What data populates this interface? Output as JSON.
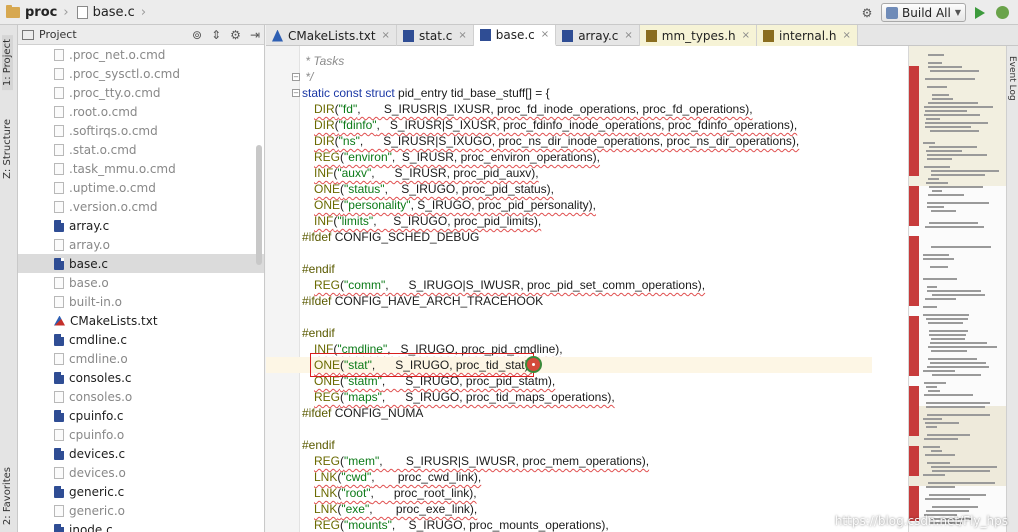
{
  "breadcrumb": {
    "folder": "proc",
    "file": "base.c"
  },
  "toolbar": {
    "build_config": "Build All",
    "icons": [
      "gear-icon",
      "build-config-icon",
      "run-icon",
      "debug-icon"
    ]
  },
  "left_stripe": {
    "tabs": [
      "1: Project",
      "Z: Structure",
      "2: Favorites"
    ]
  },
  "right_stripe": {
    "tabs": [
      "Event Log"
    ]
  },
  "project_panel": {
    "title": "Project",
    "tool_icons": [
      "sync-icon",
      "collapse-icon",
      "settings-icon",
      "hide-icon"
    ],
    "items": [
      {
        "label": ".proc_net.o.cmd",
        "kind": "obj"
      },
      {
        "label": ".proc_sysctl.o.cmd",
        "kind": "obj"
      },
      {
        "label": ".proc_tty.o.cmd",
        "kind": "obj"
      },
      {
        "label": ".root.o.cmd",
        "kind": "obj"
      },
      {
        "label": ".softirqs.o.cmd",
        "kind": "obj"
      },
      {
        "label": ".stat.o.cmd",
        "kind": "obj"
      },
      {
        "label": ".task_mmu.o.cmd",
        "kind": "obj"
      },
      {
        "label": ".uptime.o.cmd",
        "kind": "obj"
      },
      {
        "label": ".version.o.cmd",
        "kind": "obj"
      },
      {
        "label": "array.c",
        "kind": "src"
      },
      {
        "label": "array.o",
        "kind": "obj"
      },
      {
        "label": "base.c",
        "kind": "src",
        "selected": true
      },
      {
        "label": "base.o",
        "kind": "obj"
      },
      {
        "label": "built-in.o",
        "kind": "obj"
      },
      {
        "label": "CMakeLists.txt",
        "kind": "cmake"
      },
      {
        "label": "cmdline.c",
        "kind": "src"
      },
      {
        "label": "cmdline.o",
        "kind": "obj"
      },
      {
        "label": "consoles.c",
        "kind": "src"
      },
      {
        "label": "consoles.o",
        "kind": "obj"
      },
      {
        "label": "cpuinfo.c",
        "kind": "src"
      },
      {
        "label": "cpuinfo.o",
        "kind": "obj"
      },
      {
        "label": "devices.c",
        "kind": "src"
      },
      {
        "label": "devices.o",
        "kind": "obj"
      },
      {
        "label": "generic.c",
        "kind": "src"
      },
      {
        "label": "generic.o",
        "kind": "obj"
      },
      {
        "label": "inode.c",
        "kind": "src"
      }
    ]
  },
  "tabs": [
    {
      "label": "CMakeLists.txt",
      "icon": "cmake",
      "active": false
    },
    {
      "label": "stat.c",
      "icon": "src",
      "active": false
    },
    {
      "label": "base.c",
      "icon": "src",
      "active": true
    },
    {
      "label": "array.c",
      "icon": "src",
      "active": false
    },
    {
      "label": "mm_types.h",
      "icon": "hdr",
      "active": false
    },
    {
      "label": "internal.h",
      "icon": "hdr",
      "active": false
    }
  ],
  "editor": {
    "lines": [
      {
        "type": "comment",
        "text": " * Tasks"
      },
      {
        "type": "comment",
        "text": " */"
      },
      {
        "type": "decl",
        "kw": "static const struct ",
        "name": "pid_entry",
        "rest": " tid_base_stuff[] = {"
      },
      {
        "type": "entry",
        "macro": "DIR",
        "str": "\"fd\"",
        "args": ",       S_IRUSR|S_IXUSR, proc_fd_inode_operations, proc_fd_operations),"
      },
      {
        "type": "entry",
        "macro": "DIR",
        "str": "\"fdinfo\"",
        "args": ",   S_IRUSR|S_IXUSR, proc_fdinfo_inode_operations, proc_fdinfo_operations),"
      },
      {
        "type": "entry",
        "macro": "DIR",
        "str": "\"ns\"",
        "args": ",      S_IRUSR|S_IXUGO, proc_ns_dir_inode_operations, proc_ns_dir_operations),"
      },
      {
        "type": "entry",
        "macro": "REG",
        "str": "\"environ\"",
        "args": ",  S_IRUSR, proc_environ_operations),"
      },
      {
        "type": "entry",
        "macro": "INF",
        "str": "\"auxv\"",
        "args": ",      S_IRUSR, proc_pid_auxv),"
      },
      {
        "type": "entry",
        "macro": "ONE",
        "str": "\"status\"",
        "args": ",    S_IRUGO, proc_pid_status),"
      },
      {
        "type": "entry",
        "macro": "ONE",
        "str": "\"personality\"",
        "args": ", S_IRUGO, proc_pid_personality),"
      },
      {
        "type": "entry",
        "macro": "INF",
        "str": "\"limits\"",
        "args": ",     S_IRUGO, proc_pid_limits),"
      },
      {
        "type": "pp",
        "directive": "#ifdef",
        "rest": " CONFIG_SCHED_DEBUG"
      },
      {
        "type": "blank",
        "text": ""
      },
      {
        "type": "pp",
        "directive": "#endif",
        "rest": ""
      },
      {
        "type": "entry",
        "macro": "REG",
        "str": "\"comm\"",
        "args": ",      S_IRUGO|S_IWUSR, proc_pid_set_comm_operations),"
      },
      {
        "type": "pp",
        "directive": "#ifdef",
        "rest": " CONFIG_HAVE_ARCH_TRACEHOOK"
      },
      {
        "type": "blank",
        "text": ""
      },
      {
        "type": "pp",
        "directive": "#endif",
        "rest": ""
      },
      {
        "type": "entry",
        "macro": "INF",
        "str": "\"cmdline\"",
        "args": ",   S_IRUGO, proc_pid_cmdline),"
      },
      {
        "type": "entry",
        "macro": "ONE",
        "str": "\"stat\"",
        "args": ",      S_IRUGO, proc_tid_stat),",
        "current": true
      },
      {
        "type": "entry",
        "macro": "ONE",
        "str": "\"statm\"",
        "args": ",      S_IRUGO, proc_pid_statm),"
      },
      {
        "type": "entry",
        "macro": "REG",
        "str": "\"maps\"",
        "args": ",      S_IRUGO, proc_tid_maps_operations),"
      },
      {
        "type": "pp",
        "directive": "#ifdef",
        "rest": " CONFIG_NUMA"
      },
      {
        "type": "blank",
        "text": ""
      },
      {
        "type": "pp",
        "directive": "#endif",
        "rest": ""
      },
      {
        "type": "entry",
        "macro": "REG",
        "str": "\"mem\"",
        "args": ",       S_IRUSR|S_IWUSR, proc_mem_operations),"
      },
      {
        "type": "entry",
        "macro": "LNK",
        "str": "\"cwd\"",
        "args": ",       proc_cwd_link),"
      },
      {
        "type": "entry",
        "macro": "LNK",
        "str": "\"root\"",
        "args": ",      proc_root_link),"
      },
      {
        "type": "entry",
        "macro": "LNK",
        "str": "\"exe\"",
        "args": ",       proc_exe_link),"
      },
      {
        "type": "entry",
        "macro": "REG",
        "str": "\"mounts\"",
        "args": ",    S_IRUGO, proc_mounts_operations),"
      }
    ]
  },
  "watermark": "https://blog.csdn.net/Fly_hps"
}
